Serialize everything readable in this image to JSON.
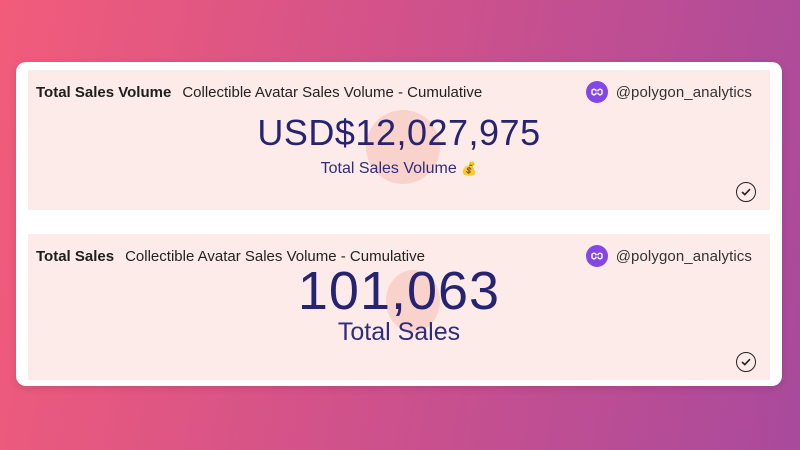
{
  "cards": [
    {
      "kind": "Total Sales Volume",
      "name": "Collectible Avatar Sales Volume - Cumulative",
      "user": "@polygon_analytics",
      "value": "USD$12,027,975",
      "caption": "Total Sales Volume",
      "caption_emoji": "💰",
      "badge_icon": "polygon-logo-icon",
      "status_icon": "check-circle-icon"
    },
    {
      "kind": "Total Sales",
      "name": "Collectible Avatar Sales Volume - Cumulative",
      "user": "@polygon_analytics",
      "value": "101,063",
      "caption": "Total Sales",
      "badge_icon": "polygon-logo-icon",
      "status_icon": "check-circle-icon"
    }
  ],
  "colors": {
    "accent": "#262471",
    "polygon_purple": "#8247e5",
    "card_bg": "#fdebe9"
  }
}
